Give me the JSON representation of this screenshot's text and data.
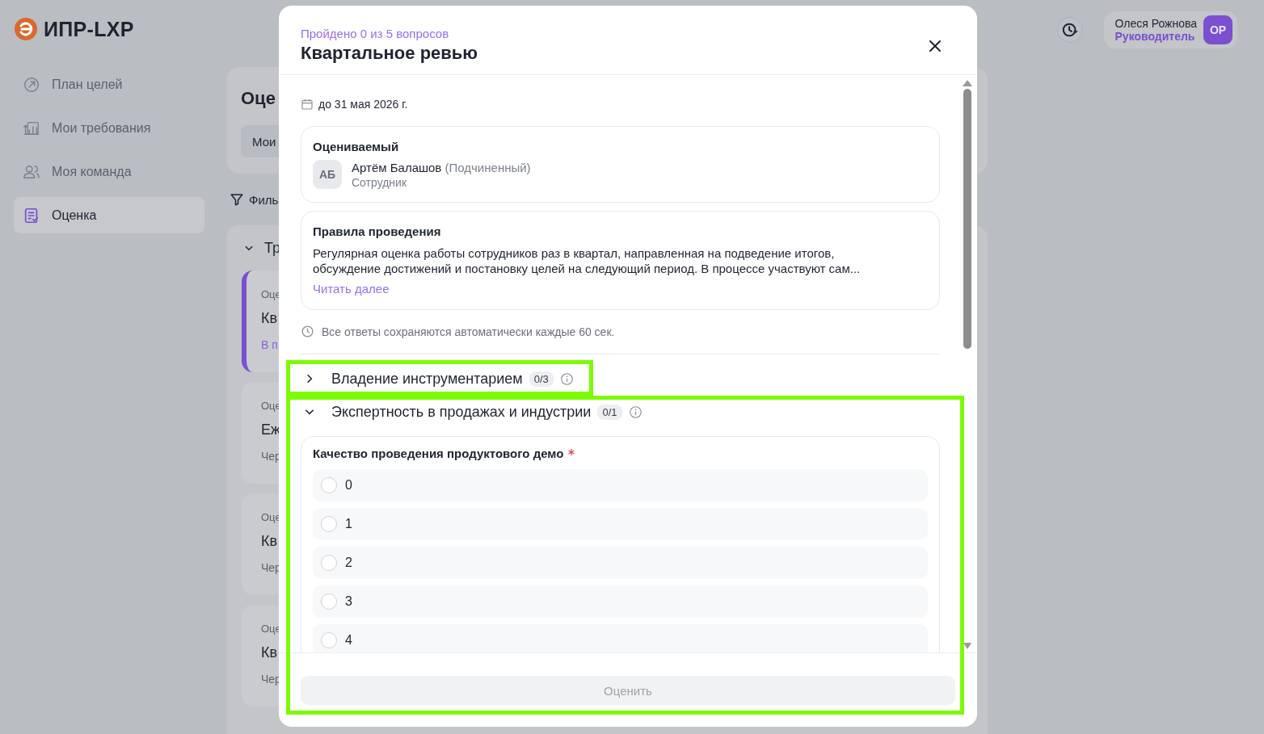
{
  "app": {
    "logo": "ИПР-LXP"
  },
  "sidebar": {
    "items": [
      {
        "label": "План целей",
        "selected": false
      },
      {
        "label": "Мои требования",
        "selected": false
      },
      {
        "label": "Моя команда",
        "selected": false
      },
      {
        "label": "Оценка",
        "selected": true
      }
    ]
  },
  "user": {
    "name": "Олеся Рожнова",
    "role": "Руководитель",
    "initials": "ОР"
  },
  "background_page": {
    "title": "Оце",
    "tab": "Мои",
    "filter": "Филь",
    "group": "Тр",
    "cards": [
      {
        "label": "Оце",
        "title": "Кв",
        "meta": "В п",
        "active": true
      },
      {
        "label": "Оце",
        "title": "Еж",
        "meta": "Чер",
        "active": false
      },
      {
        "label": "Оце",
        "title": "Кв",
        "meta": "Чер",
        "active": false
      },
      {
        "label": "Оце",
        "title": "Кв",
        "meta": "Чер",
        "active": false
      }
    ]
  },
  "modal": {
    "progress": "Пройдено 0 из 5 вопросов",
    "title": "Квартальное ревью",
    "deadline": "до 31 мая 2026 г.",
    "assessee": {
      "heading": "Оцениваемый",
      "initials": "АБ",
      "name": "Артём Балашов",
      "relation": "(Подчиненный)",
      "position": "Сотрудник"
    },
    "rules": {
      "heading": "Правила проведения",
      "text": "Регулярная оценка работы сотрудников раз в квартал, направленная на подведение итогов, обсуждение достижений и постановку целей на следующий период. В процессе участвуют сам...",
      "link": "Читать далее"
    },
    "autosave": "Все ответы сохраняются автоматически каждые 60 сек.",
    "sections": [
      {
        "title": "Владение инструментарием",
        "count": "0/3",
        "expanded": false,
        "highlighted": true
      },
      {
        "title": "Экспертность в продажах и индустрии",
        "count": "0/1",
        "expanded": true,
        "highlighted": true,
        "questions": [
          {
            "text": "Качество проведения продуктового демо",
            "required": true,
            "options": [
              {
                "label": "0",
                "selected": false
              },
              {
                "label": "1",
                "selected": false
              },
              {
                "label": "2",
                "selected": false
              },
              {
                "label": "3",
                "selected": false
              },
              {
                "label": "4",
                "selected": false
              }
            ]
          }
        ]
      }
    ],
    "submit": {
      "label": "Оценить",
      "disabled": true
    }
  }
}
